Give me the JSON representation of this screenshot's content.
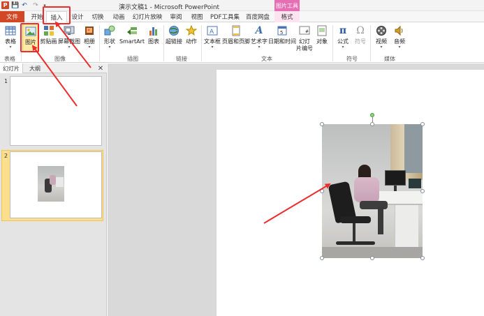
{
  "titlebar": {
    "app_icon_letter": "P",
    "title": "演示文稿1 - Microsoft PowerPoint",
    "context_label": "图片工具"
  },
  "tabs": [
    {
      "label": "文件"
    },
    {
      "label": "开始"
    },
    {
      "label": "插入"
    },
    {
      "label": "设计"
    },
    {
      "label": "切换"
    },
    {
      "label": "动画"
    },
    {
      "label": "幻灯片放映"
    },
    {
      "label": "审阅"
    },
    {
      "label": "视图"
    },
    {
      "label": "PDF工具集"
    },
    {
      "label": "百度网盘"
    },
    {
      "label": "格式"
    }
  ],
  "ribbon": {
    "buttons": {
      "table": "表格",
      "picture": "图片",
      "clipart": "剪贴画",
      "screenshot": "屏幕截图",
      "album": "相册",
      "shapes": "形状",
      "smartart": "SmartArt",
      "chart": "图表",
      "hyperlink": "超链接",
      "action": "动作",
      "textbox": "文本框",
      "header_footer": "页眉和页脚",
      "wordart": "艺术字",
      "datetime": "日期和时间",
      "slide_number_l1": "幻灯",
      "slide_number_l2": "片编号",
      "object": "对象",
      "equation": "公式",
      "symbol": "符号",
      "video": "视频",
      "audio": "音频"
    },
    "groups": {
      "tables": "表格",
      "images": "图像",
      "illustrations": "插图",
      "links": "链接",
      "text": "文本",
      "symbols": "符号",
      "media": "媒体"
    },
    "icons": {
      "equation_glyph": "π",
      "symbol_glyph": "Ω",
      "wordart_glyph": "A"
    }
  },
  "slides_pane": {
    "tab_slides": "幻灯片",
    "tab_outline": "大纲",
    "close": "✕",
    "slides": [
      {
        "number": "1"
      },
      {
        "number": "2"
      }
    ]
  },
  "colors": {
    "file_tab": "#d24726",
    "context_tab": "#e66fb4",
    "selection": "#fde9a8",
    "annotation": "#ef2c2c"
  }
}
